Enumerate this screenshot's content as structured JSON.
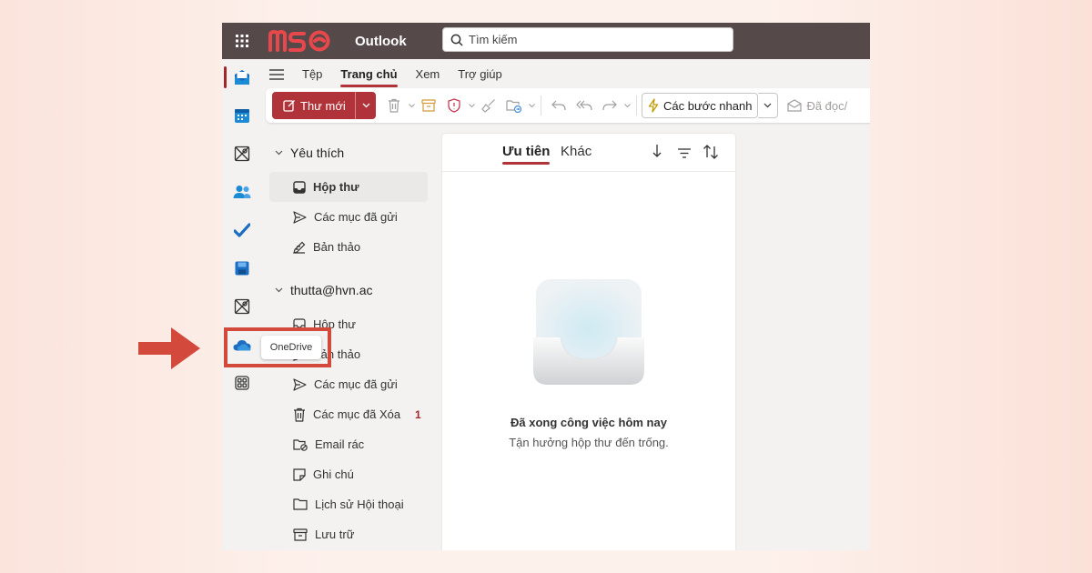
{
  "topbar": {
    "brand": "MSO",
    "app_name": "Outlook",
    "search_placeholder": "Tìm kiếm"
  },
  "rail": {
    "items": [
      "mail-icon",
      "calendar-icon",
      "app-icon",
      "people-icon",
      "todo-icon",
      "save-icon",
      "app-icon",
      "onedrive-icon",
      "more-apps-icon"
    ],
    "tooltip": "OneDrive"
  },
  "ribbon_tabs": [
    {
      "label": "Tệp"
    },
    {
      "label": "Trang chủ"
    },
    {
      "label": "Xem"
    },
    {
      "label": "Trợ giúp"
    }
  ],
  "toolbar": {
    "new_mail": "Thư mới",
    "quick_steps": "Các bước nhanh",
    "read_unread": "Đã đọc/"
  },
  "favorites": {
    "title": "Yêu thích",
    "items": [
      {
        "label": "Hộp thư"
      },
      {
        "label": "Các mục đã gửi"
      },
      {
        "label": "Bản thảo"
      }
    ]
  },
  "account": {
    "email": "thutta@hvn.ac",
    "items": [
      {
        "label": "Hộp thư"
      },
      {
        "label": "Bản thảo"
      },
      {
        "label": "Các mục đã gửi"
      },
      {
        "label": "Các mục đã Xóa",
        "count": "1"
      },
      {
        "label": "Email rác"
      },
      {
        "label": "Ghi chú"
      },
      {
        "label": "Lịch sử Hội thoại"
      },
      {
        "label": "Lưu trữ"
      }
    ]
  },
  "message_list": {
    "tab_focused": "Ưu tiên",
    "tab_other": "Khác",
    "empty_title": "Đã xong công việc hôm nay",
    "empty_subtitle": "Tận hưởng hộp thư đến trống."
  },
  "colors": {
    "accent": "#b0333a",
    "topbar": "#56494a",
    "annotation": "#d34a3d"
  }
}
